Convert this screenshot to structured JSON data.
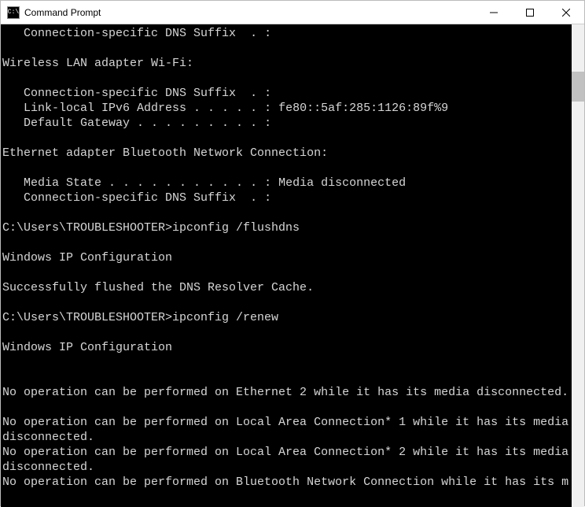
{
  "window": {
    "title": "Command Prompt"
  },
  "scrollbar": {
    "thumbTop": 60,
    "thumbHeight": 38
  },
  "terminal": {
    "lines": [
      "   Connection-specific DNS Suffix  . :",
      "",
      "Wireless LAN adapter Wi-Fi:",
      "",
      "   Connection-specific DNS Suffix  . :",
      "   Link-local IPv6 Address . . . . . : fe80::5af:285:1126:89f%9",
      "   Default Gateway . . . . . . . . . :",
      "",
      "Ethernet adapter Bluetooth Network Connection:",
      "",
      "   Media State . . . . . . . . . . . : Media disconnected",
      "   Connection-specific DNS Suffix  . :",
      "",
      "C:\\Users\\TROUBLESHOOTER>ipconfig /flushdns",
      "",
      "Windows IP Configuration",
      "",
      "Successfully flushed the DNS Resolver Cache.",
      "",
      "C:\\Users\\TROUBLESHOOTER>ipconfig /renew",
      "",
      "Windows IP Configuration",
      "",
      "",
      "No operation can be performed on Ethernet 2 while it has its media disconnected.",
      "",
      "No operation can be performed on Local Area Connection* 1 while it has its media disconnected.",
      "No operation can be performed on Local Area Connection* 2 while it has its media disconnected.",
      "No operation can be performed on Bluetooth Network Connection while it has its m"
    ]
  }
}
